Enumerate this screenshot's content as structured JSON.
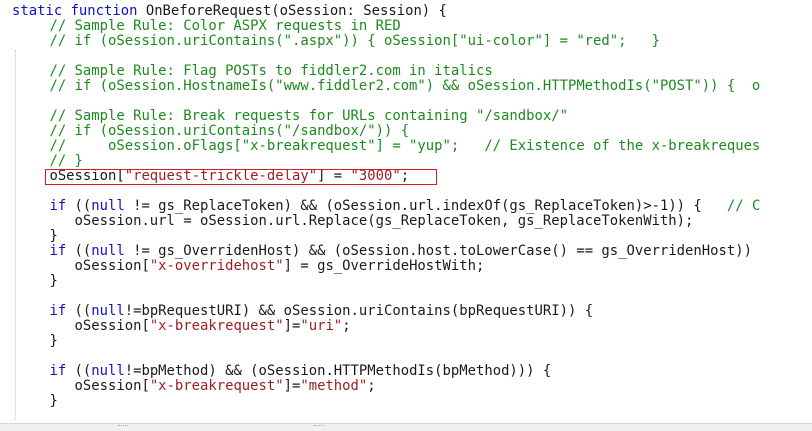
{
  "code_lines": [
    [
      {
        "t": "static",
        "c": "kw"
      },
      {
        "t": " "
      },
      {
        "t": "function",
        "c": "kw"
      },
      {
        "t": " OnBeforeRequest(oSession: Session) {"
      }
    ],
    [
      {
        "t": "    "
      },
      {
        "t": "// Sample Rule: Color ASPX requests in RED",
        "c": "cm"
      }
    ],
    [
      {
        "t": "    "
      },
      {
        "t": "// if (oSession.uriContains(\".aspx\")) { oSession[\"ui-color\"] = \"red\";   }",
        "c": "cm"
      }
    ],
    [],
    [
      {
        "t": "    "
      },
      {
        "t": "// Sample Rule: Flag POSTs to fiddler2.com in italics",
        "c": "cm"
      }
    ],
    [
      {
        "t": "    "
      },
      {
        "t": "// if (oSession.HostnameIs(\"www.fiddler2.com\") && oSession.HTTPMethodIs(\"POST\")) {  o",
        "c": "cm"
      }
    ],
    [],
    [
      {
        "t": "    "
      },
      {
        "t": "// Sample Rule: Break requests for URLs containing \"/sandbox/\"",
        "c": "cm"
      }
    ],
    [
      {
        "t": "    "
      },
      {
        "t": "// if (oSession.uriContains(\"/sandbox/\")) {",
        "c": "cm"
      }
    ],
    [
      {
        "t": "    "
      },
      {
        "t": "//     oSession.oFlags[\"x-breakrequest\"] = \"yup\";   // Existence of the x-breakreques",
        "c": "cm"
      }
    ],
    [
      {
        "t": "    "
      },
      {
        "t": "// }",
        "c": "cm"
      }
    ],
    [
      {
        "t": "    oSession["
      },
      {
        "t": "\"request-trickle-delay\"",
        "c": "str"
      },
      {
        "t": "] = "
      },
      {
        "t": "\"3000\"",
        "c": "str"
      },
      {
        "t": ";"
      }
    ],
    [],
    [
      {
        "t": "    "
      },
      {
        "t": "if",
        "c": "kw"
      },
      {
        "t": " (("
      },
      {
        "t": "null",
        "c": "kw"
      },
      {
        "t": " != gs_ReplaceToken) && (oSession.url.indexOf(gs_ReplaceToken)>-1)) {   "
      },
      {
        "t": "// C",
        "c": "cm"
      }
    ],
    [
      {
        "t": "       oSession.url = oSession.url.Replace(gs_ReplaceToken, gs_ReplaceTokenWith);"
      }
    ],
    [
      {
        "t": "    }"
      }
    ],
    [
      {
        "t": "    "
      },
      {
        "t": "if",
        "c": "kw"
      },
      {
        "t": " (("
      },
      {
        "t": "null",
        "c": "kw"
      },
      {
        "t": " != gs_OverridenHost) && (oSession.host.toLowerCase() == gs_OverridenHost))"
      }
    ],
    [
      {
        "t": "       oSession["
      },
      {
        "t": "\"x-overridehost\"",
        "c": "str"
      },
      {
        "t": "] = gs_OverrideHostWith;"
      }
    ],
    [
      {
        "t": "    }"
      }
    ],
    [],
    [
      {
        "t": "    "
      },
      {
        "t": "if",
        "c": "kw"
      },
      {
        "t": " (("
      },
      {
        "t": "null",
        "c": "kw"
      },
      {
        "t": "!=bpRequestURI) && oSession.uriContains(bpRequestURI)) {"
      }
    ],
    [
      {
        "t": "       oSession["
      },
      {
        "t": "\"x-breakrequest\"",
        "c": "str"
      },
      {
        "t": "]="
      },
      {
        "t": "\"uri\"",
        "c": "str"
      },
      {
        "t": ";"
      }
    ],
    [
      {
        "t": "    }"
      }
    ],
    [],
    [
      {
        "t": "    "
      },
      {
        "t": "if",
        "c": "kw"
      },
      {
        "t": " (("
      },
      {
        "t": "null",
        "c": "kw"
      },
      {
        "t": "!=bpMethod) && (oSession.HTTPMethodIs(bpMethod))) {"
      }
    ],
    [
      {
        "t": "       oSession["
      },
      {
        "t": "\"x-breakrequest\"",
        "c": "str"
      },
      {
        "t": "]="
      },
      {
        "t": "\"method\"",
        "c": "str"
      },
      {
        "t": ";"
      }
    ],
    [
      {
        "t": "    }"
      }
    ]
  ],
  "highlighted_line_index": 11,
  "colors": {
    "keyword": "#1111cc",
    "comment": "#1d8a1d",
    "string": "#9b1f1f",
    "plain": "#1a1a1a",
    "highlight_border": "#d41f1f"
  }
}
